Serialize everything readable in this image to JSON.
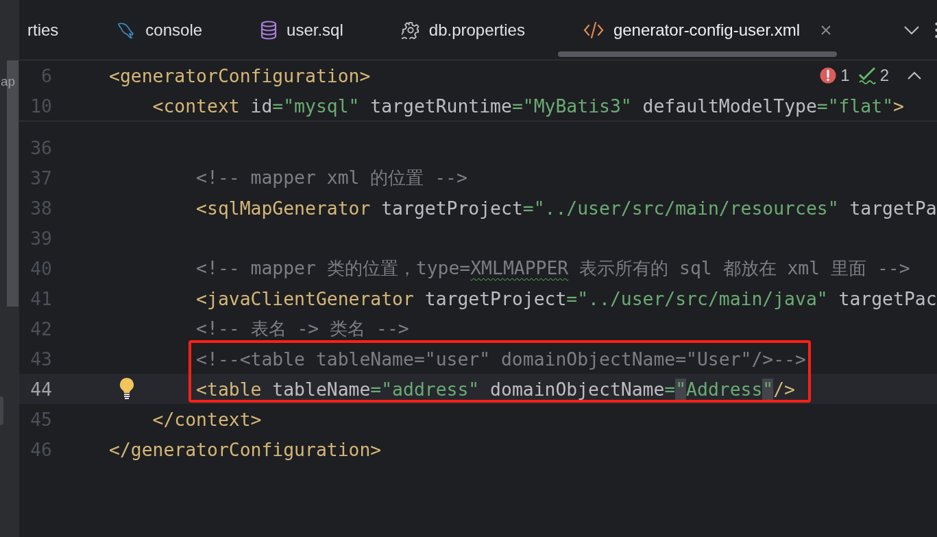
{
  "side_panel": {
    "text": "ap"
  },
  "tabs": [
    {
      "label": "rties",
      "kind": "truncated",
      "selected": false,
      "closable": false
    },
    {
      "label": "console",
      "kind": "console",
      "selected": false,
      "closable": false
    },
    {
      "label": "user.sql",
      "kind": "sql",
      "selected": false,
      "closable": false
    },
    {
      "label": "db.properties",
      "kind": "properties",
      "selected": false,
      "closable": false
    },
    {
      "label": "generator-config-user.xml",
      "kind": "xml",
      "selected": true,
      "closable": true
    }
  ],
  "inspections": [
    {
      "kind": "error",
      "count": "1"
    },
    {
      "kind": "weak_warning",
      "count": "2"
    }
  ],
  "sticky_lines": [
    {
      "number": "6",
      "tokens": [
        {
          "kind": "tag",
          "text": "<generatorConfiguration>"
        }
      ]
    },
    {
      "number": "10",
      "tokens": [
        {
          "kind": "tag",
          "text": "    <context "
        },
        {
          "kind": "attr",
          "text": "id"
        },
        {
          "kind": "value",
          "text": "=\"mysql\""
        },
        {
          "kind": "attr",
          "text": " targetRuntime"
        },
        {
          "kind": "value",
          "text": "=\"MyBatis3\""
        },
        {
          "kind": "attr",
          "text": " defaultModelType"
        },
        {
          "kind": "value",
          "text": "=\"flat\""
        },
        {
          "kind": "tag",
          "text": ">"
        }
      ]
    }
  ],
  "lines": [
    {
      "number": "36",
      "current": false,
      "bulb": false,
      "boxed": false
    },
    {
      "number": "37",
      "current": false,
      "bulb": false,
      "boxed": false,
      "tokens": [
        {
          "kind": "comment",
          "text": "        <!-- mapper xml 的位置 -->"
        }
      ]
    },
    {
      "number": "38",
      "current": false,
      "bulb": false,
      "boxed": false,
      "tokens": [
        {
          "kind": "tag",
          "text": "        <sqlMapGenerator "
        },
        {
          "kind": "attr",
          "text": "targetProject"
        },
        {
          "kind": "value",
          "text": "=\"../user/src/main/resources\""
        },
        {
          "kind": "attr",
          "text": " targetPa"
        }
      ]
    },
    {
      "number": "39",
      "current": false,
      "bulb": false,
      "boxed": false
    },
    {
      "number": "40",
      "current": false,
      "bulb": false,
      "boxed": false,
      "tokens": [
        {
          "kind": "comment",
          "text": "        <!-- mapper 类的位置，type="
        },
        {
          "kind": "typo",
          "text": "XMLMAPPER"
        },
        {
          "kind": "comment",
          "text": " 表示所有的 sql 都放在 xml 里面 -->"
        }
      ]
    },
    {
      "number": "41",
      "current": false,
      "bulb": false,
      "boxed": false,
      "tokens": [
        {
          "kind": "tag",
          "text": "        <javaClientGenerator "
        },
        {
          "kind": "attr",
          "text": "targetProject"
        },
        {
          "kind": "value",
          "text": "=\"../user/src/main/java\""
        },
        {
          "kind": "attr",
          "text": " targetPac"
        }
      ]
    },
    {
      "number": "42",
      "current": false,
      "bulb": false,
      "boxed": false,
      "tokens": [
        {
          "kind": "comment",
          "text": "        <!-- 表名 -> 类名 -->"
        }
      ]
    },
    {
      "number": "43",
      "current": false,
      "bulb": false,
      "boxed": true,
      "tokens": [
        {
          "kind": "comment",
          "text": "        <!--<table tableName=\"user\" domainObjectName=\"User\"/>-->"
        }
      ]
    },
    {
      "number": "44",
      "current": true,
      "bulb": true,
      "boxed": true,
      "tokens": [
        {
          "kind": "tag",
          "text": "        <table "
        },
        {
          "kind": "attr",
          "text": "tableName"
        },
        {
          "kind": "value",
          "text": "=\"address\""
        },
        {
          "kind": "attr",
          "text": " domainObjectName"
        },
        {
          "kind": "value",
          "text": "="
        },
        {
          "kind": "match",
          "text": "\""
        },
        {
          "kind": "value",
          "text": "Address"
        },
        {
          "kind": "match",
          "text": "\""
        },
        {
          "kind": "tag",
          "text": "/>"
        }
      ]
    },
    {
      "number": "45",
      "current": false,
      "bulb": false,
      "boxed": false,
      "tokens": [
        {
          "kind": "tag",
          "text": "    </context>"
        }
      ]
    },
    {
      "number": "46",
      "current": false,
      "bulb": false,
      "boxed": false,
      "tokens": [
        {
          "kind": "tag",
          "text": "</generatorConfiguration>"
        }
      ]
    }
  ]
}
